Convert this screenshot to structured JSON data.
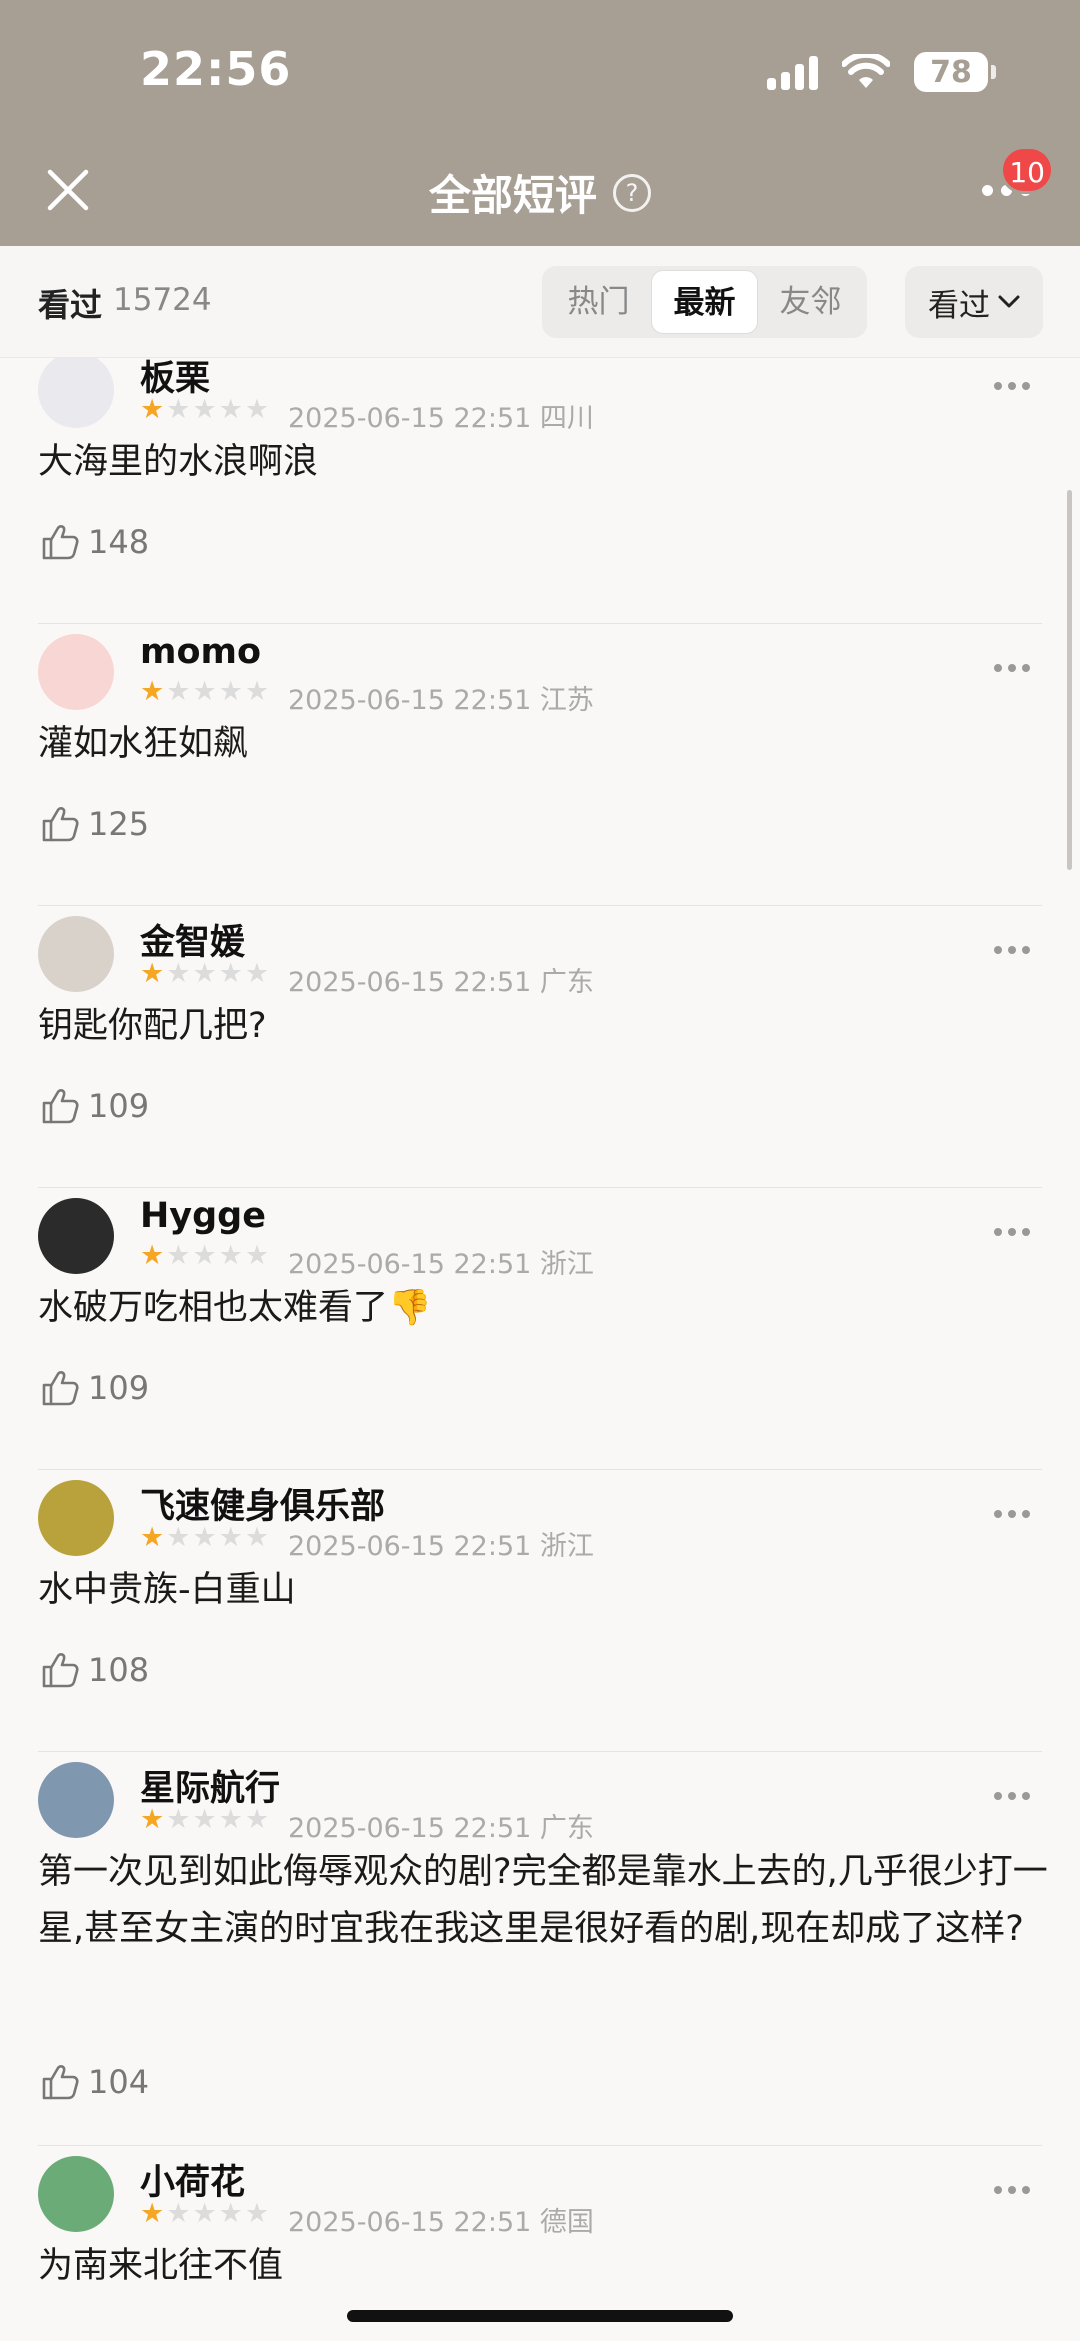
{
  "status": {
    "time": "22:56",
    "battery": "78"
  },
  "nav": {
    "title": "全部短评",
    "badge": "10"
  },
  "filter": {
    "seen_label": "看过",
    "seen_count": "15724",
    "tabs": [
      {
        "label": "热门",
        "active": false
      },
      {
        "label": "最新",
        "active": true
      },
      {
        "label": "友邻",
        "active": false
      }
    ],
    "dropdown_label": "看过"
  },
  "comments": [
    {
      "name": "板栗",
      "rating": 1,
      "date": "2025-06-15 22:51",
      "region": "四川",
      "text": "大海里的水浪啊浪",
      "likes": "148",
      "avatar_color": "#e9e9ee"
    },
    {
      "name": "momo",
      "rating": 1,
      "date": "2025-06-15 22:51",
      "region": "江苏",
      "text": "灌如水狂如飙",
      "likes": "125",
      "avatar_color": "#f8d6d4"
    },
    {
      "name": "金智媛",
      "rating": 1,
      "date": "2025-06-15 22:51",
      "region": "广东",
      "text": "钥匙你配几把?",
      "likes": "109",
      "avatar_color": "#d9d2cb"
    },
    {
      "name": "Hygge",
      "rating": 1,
      "date": "2025-06-15 22:51",
      "region": "浙江",
      "text": "水破万吃相也太难看了👎",
      "likes": "109",
      "avatar_color": "#2b2b2b"
    },
    {
      "name": "飞速健身俱乐部",
      "rating": 1,
      "date": "2025-06-15 22:51",
      "region": "浙江",
      "text": "水中贵族-白重山",
      "likes": "108",
      "avatar_color": "#b9a23c"
    },
    {
      "name": "星际航行",
      "rating": 1,
      "date": "2025-06-15 22:51",
      "region": "广东",
      "text": "第一次见到如此侮辱观众的剧?完全都是靠水上去的,几乎很少打一星,甚至女主演的时宜我在我这里是很好看的剧,现在却成了这样?",
      "likes": "104",
      "avatar_color": "#7f98b0"
    },
    {
      "name": "小荷花",
      "rating": 1,
      "date": "2025-06-15 22:51",
      "region": "德国",
      "text": "为南来北往不值",
      "likes": "",
      "avatar_color": "#6bab77"
    }
  ],
  "icons": [
    "close-icon",
    "help-icon",
    "more-icon",
    "chevron-down-icon",
    "thumb-up-icon",
    "star-icon"
  ]
}
